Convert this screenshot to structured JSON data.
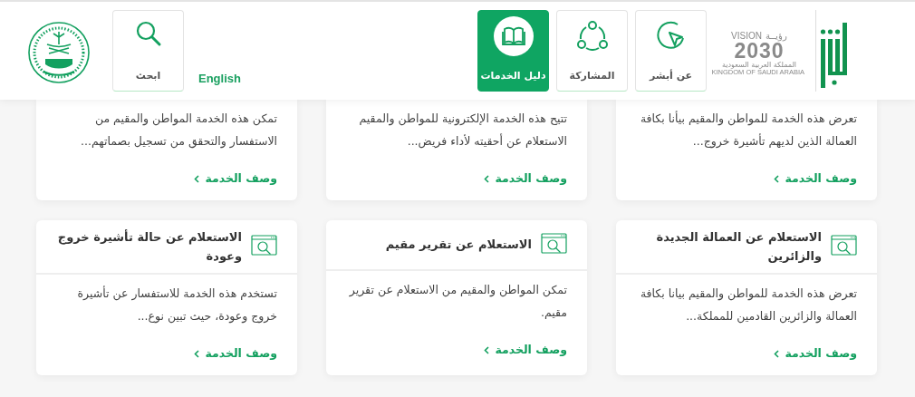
{
  "header": {
    "logo": {
      "vision": "VISION",
      "vision_ar": "رؤيــة",
      "year": "2030",
      "country_ar": "المملكة العربية السعودية",
      "country_en": "KINGDOM OF SAUDI ARABIA"
    },
    "nav": [
      {
        "label": "عن أبشر",
        "kind": "cursor",
        "selected": false
      },
      {
        "label": "المشاركة",
        "kind": "share",
        "selected": false
      },
      {
        "label": "دليل الخدمات",
        "kind": "book",
        "selected": true
      }
    ],
    "language": "English",
    "search": {
      "label": "ابحث"
    }
  },
  "services": [
    {
      "description": "تعرض هذه الخدمة للمواطن والمقيم بيأنا بكافة العمالة الذين لديهم تأشيرة خروج...",
      "link": "وصف الخدمة"
    },
    {
      "description": "تتيح هذه الخدمة الإلكترونية للمواطن والمقيم الاستعلام عن أحقيته لأداء فريض...",
      "link": "وصف الخدمة"
    },
    {
      "description": "تمكن هذه الخدمة المواطن والمقيم من الاستفسار والتحقق من تسجيل بصماتهم...",
      "link": "وصف الخدمة"
    },
    {
      "title": "الاستعلام عن العمالة الجديدة والزائرين",
      "description": "تعرض هذه الخدمة للمواطن والمقيم بيانا بكافة العمالة والزائرين القادمين للمملكة...",
      "link": "وصف الخدمة"
    },
    {
      "title": "الاستعلام عن تقرير مقيم",
      "description": "تمكن المواطن والمقيم من الاستعلام عن تقرير مقيم.",
      "link": "وصف الخدمة"
    },
    {
      "title": "الاستعلام عن حالة تأشيرة خروج وعودة",
      "description": "تستخدم هذه الخدمة للاستفسار عن تأشيرة خروج وعودة، حيث تبين نوع...",
      "link": "وصف الخدمة"
    }
  ]
}
